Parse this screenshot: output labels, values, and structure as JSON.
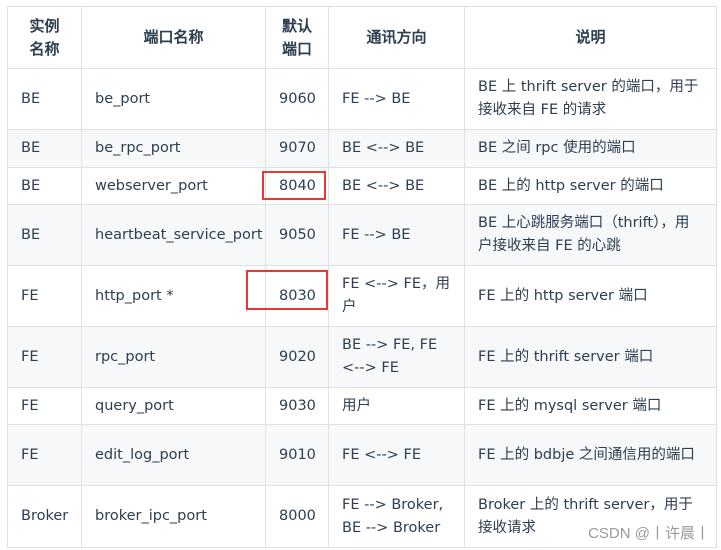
{
  "table": {
    "headers": [
      "实例\n名称",
      "端口名称",
      "默认\n端口",
      "通讯方向",
      "说明"
    ],
    "rows": [
      {
        "instance": "BE",
        "port_name": "be_port",
        "port": "9060",
        "direction": "FE --> BE",
        "description": "BE 上 thrift server 的端口，用于接收来自 FE 的请求"
      },
      {
        "instance": "BE",
        "port_name": "be_rpc_port",
        "port": "9070",
        "direction": "BE <--> BE",
        "description": "BE 之间 rpc 使用的端口"
      },
      {
        "instance": "BE",
        "port_name": "webserver_port",
        "port": "8040",
        "direction": "BE <--> BE",
        "description": "BE 上的 http server 的端口",
        "highlighted": true
      },
      {
        "instance": "BE",
        "port_name": "heartbeat_service_port",
        "port": "9050",
        "direction": "FE --> BE",
        "description": "BE 上心跳服务端口（thrift），用户接收来自 FE 的心跳"
      },
      {
        "instance": "FE",
        "port_name": "http_port *",
        "port": "8030",
        "direction": "FE <--> FE，用户",
        "description": "FE 上的 http server 端口",
        "highlighted": true
      },
      {
        "instance": "FE",
        "port_name": "rpc_port",
        "port": "9020",
        "direction": "BE --> FE, FE <--> FE",
        "description": "FE 上的 thrift server 端口"
      },
      {
        "instance": "FE",
        "port_name": "query_port",
        "port": "9030",
        "direction": "用户",
        "description": "FE 上的 mysql server 端口"
      },
      {
        "instance": "FE",
        "port_name": "edit_log_port",
        "port": "9010",
        "direction": "FE <--> FE",
        "description": "FE 上的 bdbje 之间通信用的端口"
      },
      {
        "instance": "Broker",
        "port_name": "broker_ipc_port",
        "port": "8000",
        "direction": "FE --> Broker, BE --> Broker",
        "description": "Broker 上的 thrift server，用于接收请求"
      }
    ]
  },
  "highlight_color": "#e53935",
  "watermark": "CSDN @丨许晨丨"
}
